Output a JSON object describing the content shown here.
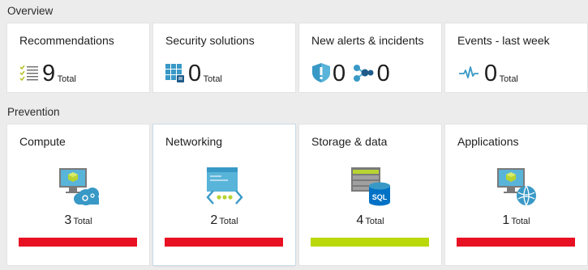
{
  "overview": {
    "label": "Overview",
    "tiles": [
      {
        "title": "Recommendations",
        "value": "9",
        "unit": "Total",
        "icon": "checklist-icon"
      },
      {
        "title": "Security solutions",
        "value": "0",
        "unit": "Total",
        "icon": "solutions-grid-icon"
      },
      {
        "title": "New alerts & incidents",
        "alerts_value": "0",
        "incidents_value": "0",
        "icons": [
          "shield-alert-icon",
          "incident-nodes-icon"
        ]
      },
      {
        "title": "Events - last week",
        "value": "0",
        "unit": "Total",
        "icon": "pulse-icon"
      }
    ]
  },
  "prevention": {
    "label": "Prevention",
    "tiles": [
      {
        "title": "Compute",
        "value": "3",
        "unit": "Total",
        "icon": "compute-icon",
        "status_color": "#e81123",
        "bar_fill": 1.0
      },
      {
        "title": "Networking",
        "value": "2",
        "unit": "Total",
        "icon": "networking-icon",
        "status_color": "#e81123",
        "bar_fill": 1.0
      },
      {
        "title": "Storage & data",
        "value": "4",
        "unit": "Total",
        "icon": "storage-sql-icon",
        "status_color": "#bad80a",
        "bar_fill": 1.0
      },
      {
        "title": "Applications",
        "value": "1",
        "unit": "Total",
        "icon": "applications-icon",
        "status_color": "#e81123",
        "bar_fill": 1.0
      }
    ]
  }
}
